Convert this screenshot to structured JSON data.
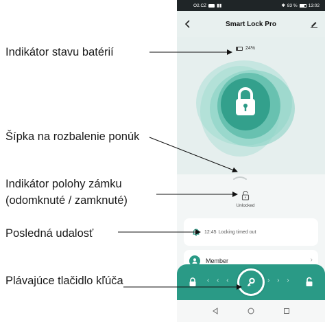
{
  "annotations": {
    "battery": "Indikátor stavu batérií",
    "arrow": "Šípka na rozbalenie ponúk",
    "lock_position": "Indikátor polohy zámku (odomknuté / zamknuté)",
    "last_event": "Posledná udalosť",
    "key_button": "Plávajúce tlačidlo kľúča"
  },
  "status_bar": {
    "carrier": "O2.CZ",
    "battery": "83 %",
    "time": "13:02"
  },
  "app": {
    "title": "Smart Lock Pro",
    "battery_level": "24%",
    "lock_state": "Unlocked",
    "last_event": {
      "time": "12:45",
      "text": "Locking timed out"
    },
    "member_label": "Member"
  },
  "colors": {
    "accent": "#2a9a86",
    "hero_bg": "#e6efee",
    "blob_light": "#7fd1c2",
    "blob_dark": "#2a9a86"
  },
  "icons": {
    "back": "back-arrow-icon",
    "edit": "edit-pencil-icon",
    "battery": "battery-icon",
    "padlock": "padlock-icon",
    "chevron_up": "chevron-up-icon",
    "unlocked": "unlocked-padlock-icon",
    "event": "bell-icon",
    "member": "person-icon",
    "key": "key-icon"
  }
}
